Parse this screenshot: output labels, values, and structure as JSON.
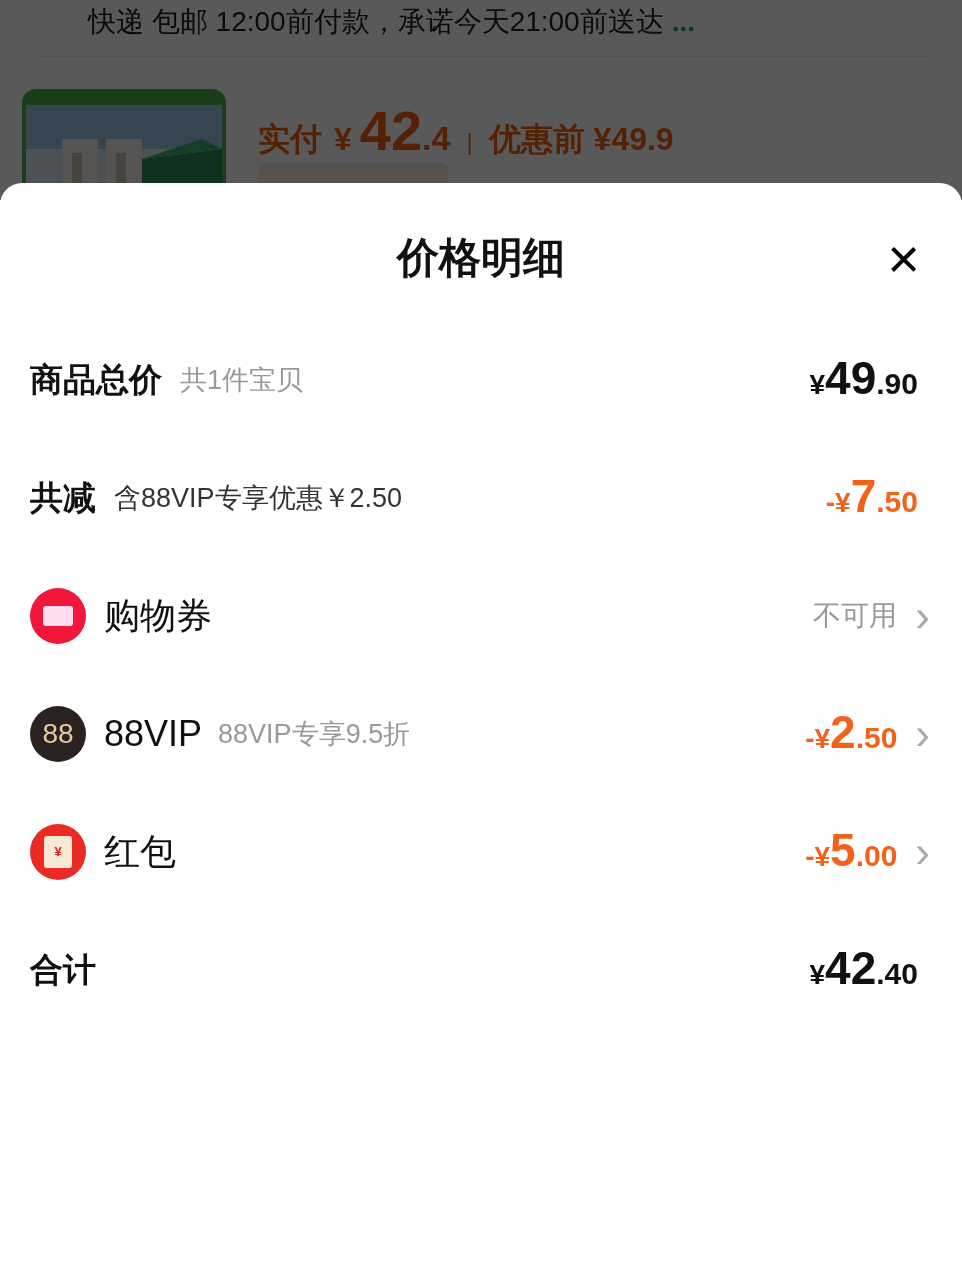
{
  "background": {
    "delivery": "快递 包邮 12:00前付款，承诺今天21:00前送达",
    "more": "...",
    "product": {
      "kind": "picture",
      "paid_label": "实付",
      "currency": "¥",
      "paid_integer": "42",
      "paid_decimal": ".4",
      "separator": "|",
      "original": "优惠前 ¥49.9"
    }
  },
  "sheet": {
    "title": "价格明细",
    "close": "×",
    "rows": [
      {
        "kind": "summary",
        "label": "商品总价",
        "sub": "共1件宝贝",
        "amount": {
          "currency": "¥",
          "integer": "49",
          "decimal": ".90"
        },
        "discount": false
      },
      {
        "kind": "summary",
        "label": "共减",
        "sub": "含88VIP专享优惠￥2.50",
        "amount": {
          "sign": "-",
          "currency": "¥",
          "integer": "7",
          "decimal": ".50"
        },
        "discount": true
      },
      {
        "kind": "coupon",
        "label": "购物券",
        "status": "不可用",
        "chevron": "›"
      },
      {
        "kind": "membership",
        "icon_text": "88",
        "label": "88VIP",
        "sub": "88VIP专享9.5折",
        "amount": {
          "sign": "-",
          "currency": "¥",
          "integer": "2",
          "decimal": ".50"
        },
        "discount": true,
        "chevron": "›"
      },
      {
        "kind": "packet",
        "icon_text": "¥",
        "label": "红包",
        "amount": {
          "sign": "-",
          "currency": "¥",
          "integer": "5",
          "decimal": ".00"
        },
        "discount": true,
        "chevron": "›"
      },
      {
        "kind": "summary",
        "label": "合计",
        "amount": {
          "currency": "¥",
          "integer": "42",
          "decimal": ".40"
        },
        "discount": false
      }
    ]
  }
}
